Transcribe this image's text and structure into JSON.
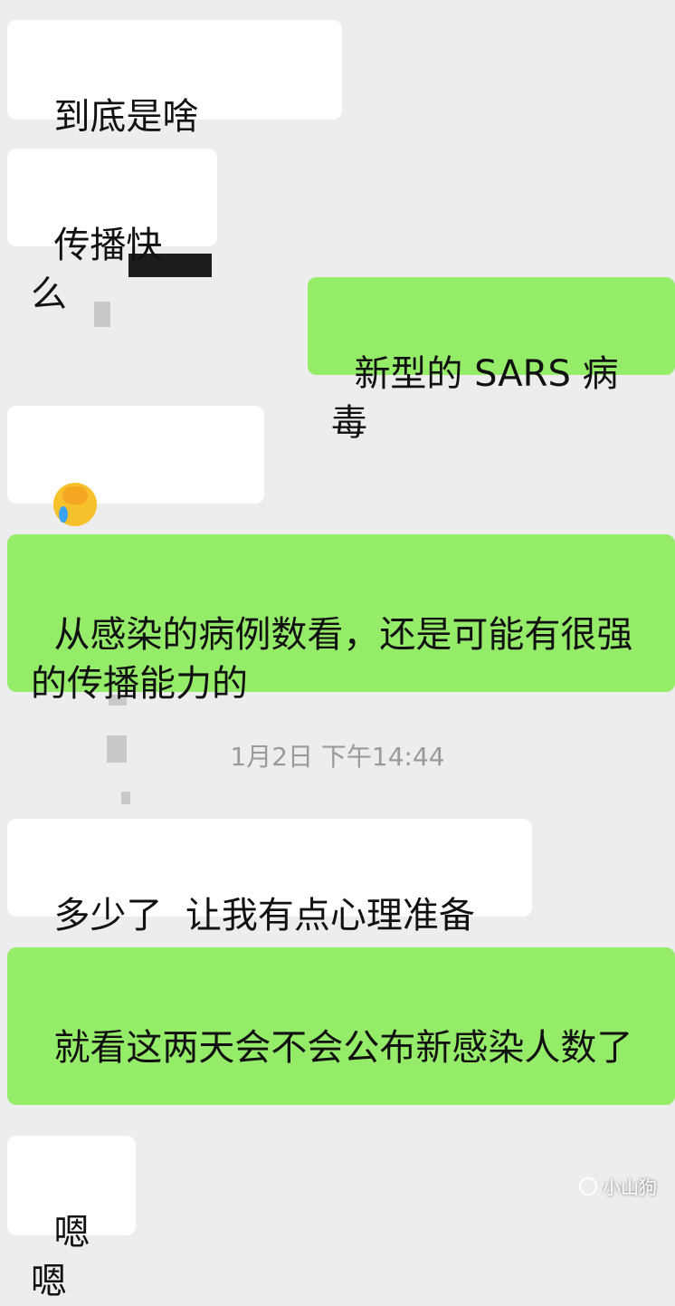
{
  "messages": [
    {
      "side": "received",
      "text": "到底是啥"
    },
    {
      "side": "received",
      "text": "传播快么"
    },
    {
      "side": "sent",
      "text": "新型的 SARS 病毒"
    },
    {
      "side": "received",
      "text": "",
      "emoji": "face-palm-crying-emoji"
    },
    {
      "side": "sent",
      "text": "从感染的病例数看，还是可能有很强的传播能力的"
    },
    {
      "side": "received",
      "text": "多少了  让我有点心理准备"
    },
    {
      "side": "sent",
      "text": "就看这两天会不会公布新感染人数了"
    },
    {
      "side": "received",
      "text": "嗯嗯"
    }
  ],
  "timestamp": "1月2日 下午14:44",
  "watermark": {
    "text": "小山狗",
    "icon": "wechat-official-icon"
  },
  "colors": {
    "background": "#ededed",
    "received_bubble": "#ffffff",
    "sent_bubble": "#95ec69",
    "timestamp": "#9a9a9a"
  }
}
